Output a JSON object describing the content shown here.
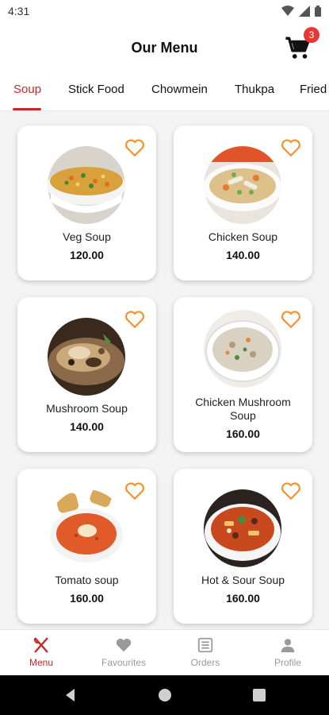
{
  "status_bar": {
    "time": "4:31"
  },
  "header": {
    "title": "Our Menu",
    "cart_count": "3"
  },
  "tabs": [
    {
      "label": "Soup",
      "active": true
    },
    {
      "label": "Stick Food",
      "active": false
    },
    {
      "label": "Chowmein",
      "active": false
    },
    {
      "label": "Thukpa",
      "active": false
    },
    {
      "label": "Fried",
      "active": false
    }
  ],
  "items": [
    {
      "name": "Veg Soup",
      "price": "120.00",
      "image": "veg-soup"
    },
    {
      "name": "Chicken Soup",
      "price": "140.00",
      "image": "chicken-soup"
    },
    {
      "name": "Mushroom Soup",
      "price": "140.00",
      "image": "mushroom-soup"
    },
    {
      "name": "Chicken Mushroom Soup",
      "price": "160.00",
      "image": "chicken-mushroom-soup"
    },
    {
      "name": "Tomato soup",
      "price": "160.00",
      "image": "tomato-soup"
    },
    {
      "name": "Hot & Sour Soup",
      "price": "160.00",
      "image": "hot-sour-soup"
    }
  ],
  "bottom_nav": [
    {
      "label": "Menu",
      "icon": "fork-knife-icon",
      "active": true
    },
    {
      "label": "Favourites",
      "icon": "heart-icon",
      "active": false
    },
    {
      "label": "Orders",
      "icon": "orders-icon",
      "active": false
    },
    {
      "label": "Profile",
      "icon": "profile-icon",
      "active": false
    }
  ],
  "colors": {
    "accent": "#c62828",
    "favourite": "#f5922b",
    "badge": "#e53935"
  }
}
